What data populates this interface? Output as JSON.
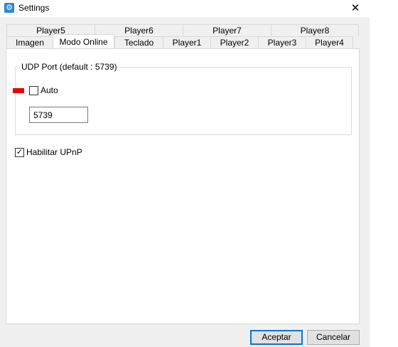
{
  "window": {
    "title": "Settings",
    "close_glyph": "✕",
    "icon": "settings-gear-icon"
  },
  "tabs": {
    "back_row": [
      {
        "label": "Player5"
      },
      {
        "label": "Player6"
      },
      {
        "label": "Player7"
      },
      {
        "label": "Player8"
      }
    ],
    "front_row": [
      {
        "label": "Imagen"
      },
      {
        "label": "Modo Online",
        "active": true
      },
      {
        "label": "Teclado"
      },
      {
        "label": "Player1"
      },
      {
        "label": "Player2"
      },
      {
        "label": "Player3"
      },
      {
        "label": "Player4"
      }
    ]
  },
  "udp_group": {
    "title": "UDP Port (default : 5739)",
    "auto_label": "Auto",
    "auto_checked": false,
    "port_value": "5739"
  },
  "upnp": {
    "label": "Habilitar UPnP",
    "checked": true,
    "check_glyph": "✓"
  },
  "buttons": {
    "accept": "Aceptar",
    "cancel": "Cancelar"
  },
  "colors": {
    "accent": "#0078d7",
    "marker": "#ee0000",
    "icon_bg": "#2b88d8"
  }
}
